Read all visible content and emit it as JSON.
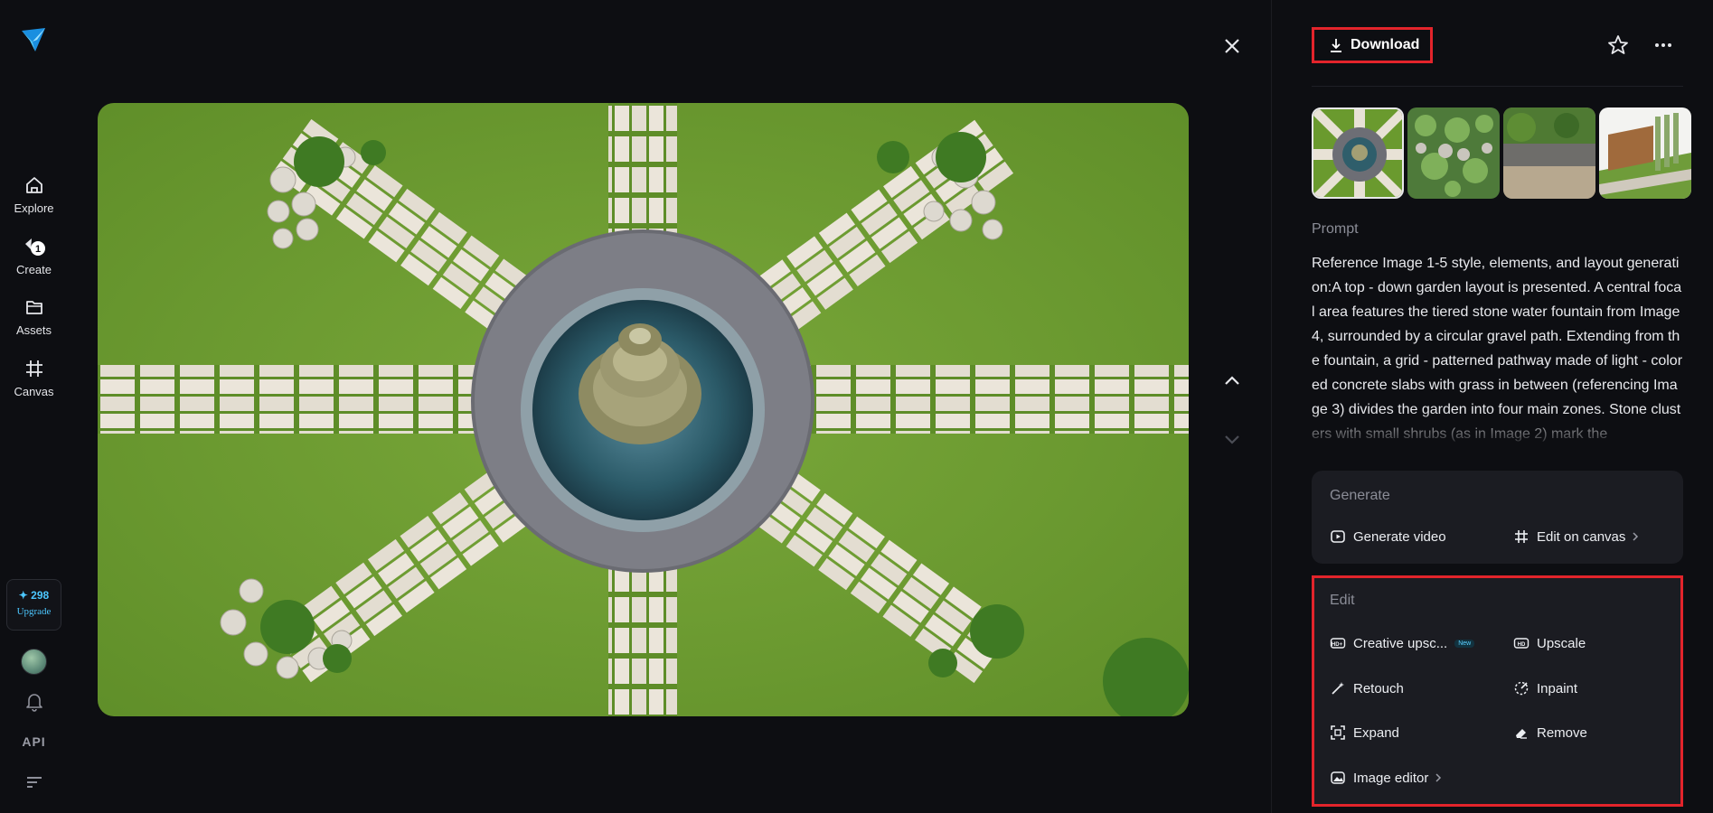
{
  "nav": {
    "items": [
      {
        "label": "Explore",
        "icon": "home-icon"
      },
      {
        "label": "Create",
        "icon": "create-icon",
        "badge": "1"
      },
      {
        "label": "Assets",
        "icon": "folder-icon"
      },
      {
        "label": "Canvas",
        "icon": "canvas-icon"
      }
    ],
    "credits": "298",
    "upgrade": "Upgrade",
    "api": "API"
  },
  "toolbar": {
    "download_label": "Download"
  },
  "prompt": {
    "heading": "Prompt",
    "text": "Reference Image 1-5 style, elements, and layout generation:A top - down garden layout is presented. A central focal area features the tiered stone water fountain from Image 4, surrounded by a circular gravel path. Extending from the fountain, a grid - patterned pathway made of light - colored concrete slabs with grass in between (referencing Image 3) divides the garden into four main zones. Stone clusters with small shrubs (as in Image 2) mark the"
  },
  "generate": {
    "heading": "Generate",
    "video": "Generate video",
    "canvas": "Edit on canvas"
  },
  "edit": {
    "heading": "Edit",
    "creative_upscale": "Creative upsc...",
    "new_badge": "New",
    "upscale": "Upscale",
    "retouch": "Retouch",
    "inpaint": "Inpaint",
    "expand": "Expand",
    "remove": "Remove",
    "image_editor": "Image editor"
  },
  "colors": {
    "accent": "#4cc7ff",
    "highlight": "#e3242b",
    "grass": "#6a9a2e"
  }
}
